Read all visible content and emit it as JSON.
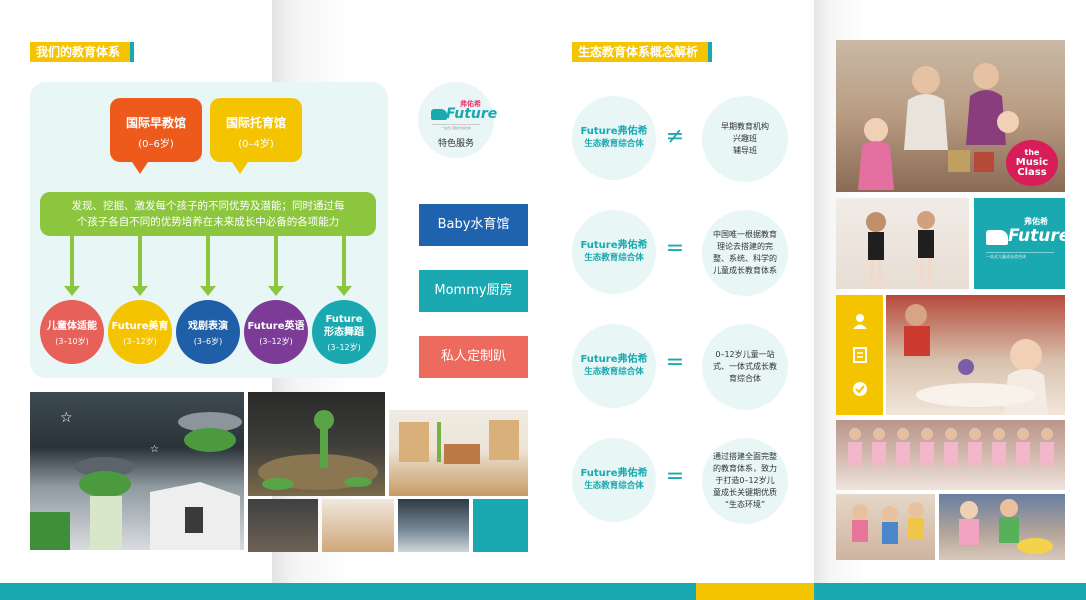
{
  "colors": {
    "teal": "#1aa9b0",
    "yellow": "#f5c400",
    "orange": "#ee5a1b",
    "green": "#8cc63f",
    "red": "#e8605a",
    "navy": "#1f5fa8",
    "purple": "#7b3b97",
    "blue_btn": "#1f63ae",
    "coral_btn": "#ec6a5e"
  },
  "left_page": {
    "section_title": "我们的教育体系",
    "bubbles": [
      {
        "title": "国际早教馆",
        "sub": "(0–6岁)"
      },
      {
        "title": "国际托育馆",
        "sub": "(0–4岁)"
      }
    ],
    "mission_line1": "发现、挖掘、激发每个孩子的不同优势及潜能；同时通过每",
    "mission_line2": "个孩子各自不同的优势培养在未来成长中必备的各项能力",
    "programs": [
      {
        "name": "儿童体适能",
        "age": "(3–10岁)"
      },
      {
        "name": "Future美育",
        "age": "(3–12岁)"
      },
      {
        "name": "戏剧表演",
        "age": "(3–6岁)"
      },
      {
        "name": "Future英语",
        "age": "(3–12岁)"
      },
      {
        "name_line1": "Future",
        "name_line2": "形态舞蹈",
        "age": "(3–12岁)"
      }
    ]
  },
  "brand": {
    "cn": "弗佑希",
    "en": "Future",
    "tagline": "一站式儿童成长综合体"
  },
  "special_services_label": "特色服务",
  "services": [
    "Baby水育馆",
    "Mommy厨房",
    "私人定制趴"
  ],
  "right_page": {
    "section_title": "生态教育体系概念解析",
    "rows": [
      {
        "line1": "Future弗佑希",
        "line2": "生态教育综合体",
        "symbol": "≠",
        "desc": [
          "早期教育机构",
          "兴趣班",
          "辅导班"
        ]
      },
      {
        "line1": "Future弗佑希",
        "line2": "生态教育综合体",
        "symbol": "=",
        "desc": [
          "中国唯一根据教育",
          "理论去搭建的完",
          "整、系统、科学的",
          "儿童成长教育体系"
        ]
      },
      {
        "line1": "Future弗佑希",
        "line2": "生态教育综合体",
        "symbol": "=",
        "desc": [
          "0–12岁儿童一站",
          "式、一体式成长教",
          "育综合体"
        ]
      },
      {
        "line1": "Future弗佑希",
        "line2": "生态教育综合体",
        "symbol": "=",
        "desc": [
          "通过搭建全面完整",
          "的教育体系，致力",
          "于打造0–12岁儿",
          "童成长关键期优质",
          "“生态环境”"
        ]
      }
    ]
  },
  "music_class_badge": {
    "line1": "the",
    "line2": "Music",
    "line3": "Class"
  },
  "icons": {
    "strip": [
      "user-icon",
      "document-icon",
      "check-icon"
    ]
  }
}
